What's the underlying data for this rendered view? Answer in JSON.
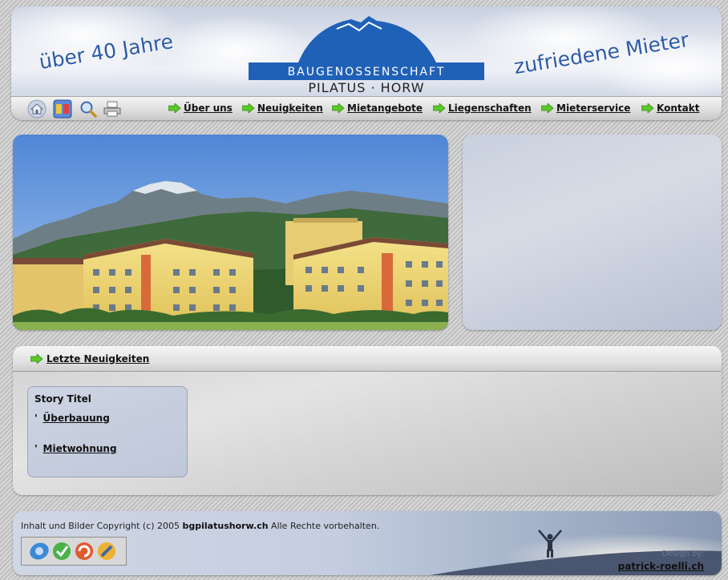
{
  "header": {
    "slogan_left": "über 40 Jahre",
    "slogan_right": "zufriedene Mieter",
    "logo_main": "BAUGENOSSENSCHAFT",
    "logo_sub": "PILATUS · HORW",
    "tool_icons": [
      "home-icon",
      "contact-card-icon",
      "search-icon",
      "print-icon"
    ],
    "nav": [
      {
        "label": "Über uns"
      },
      {
        "label": "Neuigkeiten"
      },
      {
        "label": "Mietangebote"
      },
      {
        "label": "Liegenschaften"
      },
      {
        "label": "Mieterservice"
      },
      {
        "label": "Kontakt"
      }
    ]
  },
  "news": {
    "title": "Letzte Neuigkeiten",
    "story_title": "Story Titel",
    "items": [
      {
        "bullet": "'",
        "label": "Überbauung"
      },
      {
        "bullet": "'",
        "label": "Mietwohnung"
      }
    ]
  },
  "footer": {
    "copyright_prefix": "Inhalt und Bilder Copyright (c) 2005",
    "copyright_domain": "bgpilatushorw.ch",
    "copyright_suffix": "Alle Rechte vorbehalten.",
    "design_by": "Design by:",
    "designer": "patrick-roelli.ch"
  },
  "colors": {
    "accent_blue": "#2061b8",
    "arrow_green": "#5ac82a"
  }
}
